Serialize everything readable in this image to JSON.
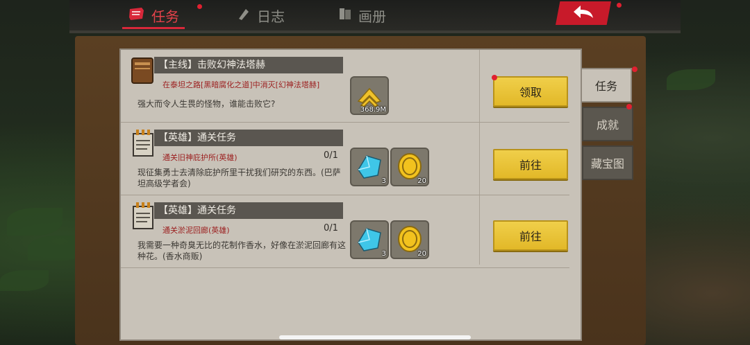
{
  "top_tabs": [
    {
      "label": "任务",
      "icon": "scroll-icon",
      "active": true
    },
    {
      "label": "日志",
      "icon": "feather-icon",
      "active": false
    },
    {
      "label": "画册",
      "icon": "book-icon",
      "active": false
    }
  ],
  "back_button": {
    "icon": "back-arrow-icon"
  },
  "quests": [
    {
      "title": "【主线】击败幻神法塔赫",
      "subtitle": "在泰坦之路[黑暗腐化之道]中消灭[幻神法塔赫]",
      "progress": "",
      "description": "强大而令人生畏的怪物，谁能击败它?",
      "icon": "book-icon",
      "rewards": [
        {
          "icon": "gold-chevron-icon",
          "qty": "368.9M"
        }
      ],
      "button": "领取",
      "button_dot": true
    },
    {
      "title": "【英雄】通关任务",
      "subtitle": "通关旧神庇护所(英雄)",
      "progress": "0/1",
      "description": "现征集勇士去清除庇护所里干扰我们研究的东西。(巴萨坦高级学者会)",
      "icon": "notepad-icon",
      "rewards": [
        {
          "icon": "blue-crystal-icon",
          "qty": "3"
        },
        {
          "icon": "gold-coin-icon",
          "qty": "20"
        }
      ],
      "button": "前往",
      "button_dot": false
    },
    {
      "title": "【英雄】通关任务",
      "subtitle": "通关淤泥回廊(英雄)",
      "progress": "0/1",
      "description": "我需要一种奇臭无比的花制作香水，好像在淤泥回廊有这种花。(香水商贩)",
      "icon": "notepad-icon",
      "rewards": [
        {
          "icon": "blue-crystal-icon",
          "qty": "3"
        },
        {
          "icon": "gold-coin-icon",
          "qty": "20"
        }
      ],
      "button": "前往",
      "button_dot": false
    }
  ],
  "side_tabs": [
    {
      "label": "任务",
      "active": true,
      "dot": true
    },
    {
      "label": "成就",
      "active": false,
      "dot": true
    },
    {
      "label": "藏宝图",
      "active": false,
      "dot": false
    }
  ],
  "colors": {
    "accent_red": "#d8283a",
    "button_yellow": "#e8c43a",
    "panel": "#c8c2b8"
  }
}
